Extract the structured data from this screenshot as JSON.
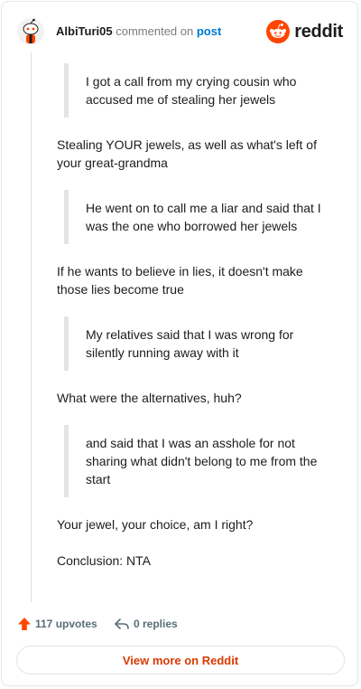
{
  "header": {
    "username": "AlbiTuri05",
    "action_text": "commented on",
    "post_link": "post",
    "logo_text": "reddit",
    "avatar_icon": "reddit-snoo-avatar-icon"
  },
  "colors": {
    "reddit_orange": "#ff4500",
    "link_blue": "#0079d3",
    "view_more_text": "#d93a00"
  },
  "comment": {
    "blocks": [
      {
        "type": "quote",
        "text": "I got a call from my crying cousin who accused me of stealing her jewels"
      },
      {
        "type": "para",
        "text": "Stealing YOUR jewels, as well as what's left of your great-grandma"
      },
      {
        "type": "quote",
        "text": "He went on to call me a liar and said that I was the one who borrowed her jewels"
      },
      {
        "type": "para",
        "text": "If he wants to believe in lies, it doesn't make those lies become true"
      },
      {
        "type": "quote",
        "text": "My relatives said that I was wrong for silently running away with it"
      },
      {
        "type": "para",
        "text": "What were the alternatives, huh?"
      },
      {
        "type": "quote",
        "text": "and said that I was an asshole for not sharing what didn't belong to me from the start"
      },
      {
        "type": "para",
        "text": "Your jewel, your choice, am I right?"
      },
      {
        "type": "para",
        "text": "Conclusion: NTA"
      }
    ]
  },
  "footer": {
    "upvotes": "117 upvotes",
    "replies": "0 replies",
    "upvote_icon": "upvote-arrow-icon",
    "reply_icon": "reply-arrow-icon"
  },
  "view_more": {
    "label": "View more on Reddit"
  }
}
